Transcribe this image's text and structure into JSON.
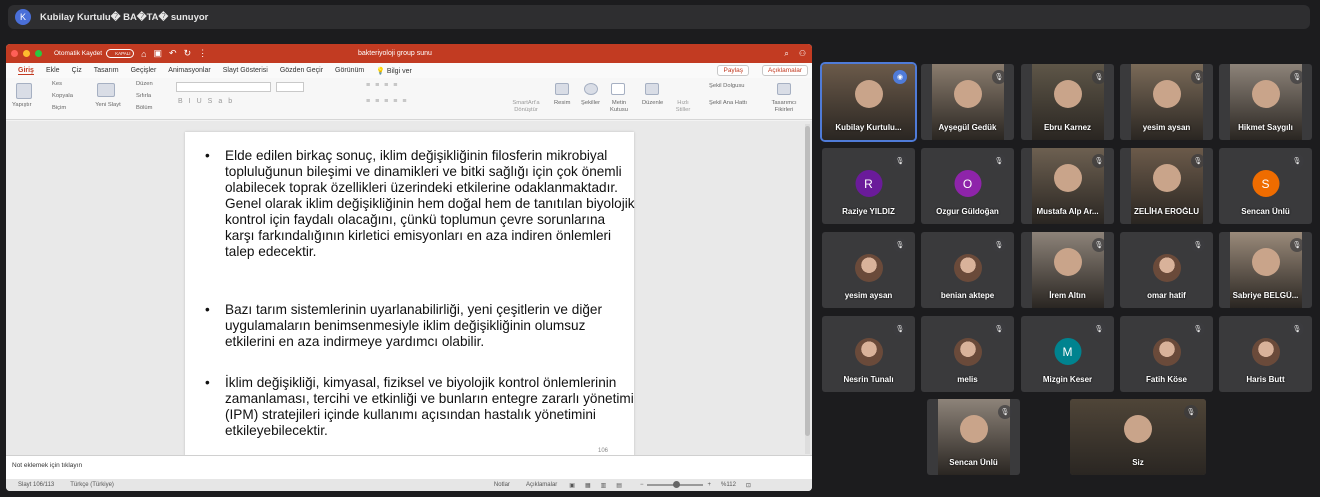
{
  "meeting": {
    "presenter_initial": "K",
    "presenter_banner": "Kubilay Kurtulu� BA�TA� sunuyor"
  },
  "ppt": {
    "autosave_label": "Otomatik Kaydet",
    "autosave_state": "KAPALI",
    "document_title": "bakteriyoloji group sunu",
    "tabs": [
      "Giriş",
      "Ekle",
      "Çiz",
      "Tasarım",
      "Geçişler",
      "Animasyonlar",
      "Slayt Gösterisi",
      "Gözden Geçir",
      "Görünüm",
      "Bilgi ver"
    ],
    "share_label": "Paylaş",
    "comments_label": "Açıklamalar",
    "ribbon": {
      "paste": "Yapıştır",
      "cut": "Kes",
      "copy": "Kopyala",
      "format": "Biçim",
      "new_slide": "Yeni Slayt",
      "layout": "Düzen",
      "reset": "Sıfırla",
      "section": "Bölüm",
      "smartart": "SmartArt'a Dönüştür",
      "picture": "Resim",
      "shapes": "Şekiller",
      "textbox": "Metin Kutusu",
      "arrange": "Düzenle",
      "quick_styles": "Hızlı Stiller",
      "shape_fill": "Şekil Dolgusu",
      "shape_outline": "Şekil Ana Hattı",
      "designer": "Tasarımcı Fikirleri"
    },
    "slide": {
      "bullet1": "Elde edilen birkaç sonuç, iklim değişikliğinin filosferin mikrobiyal topluluğunun bileşimi ve dinamikleri ve bitki sağlığı için çok önemli olabilecek toprak özellikleri üzerindeki etkilerine odaklanmaktadır. Genel olarak iklim değişikliğinin hem doğal hem de tanıtılan biyolojik kontrol için faydalı olacağını, çünkü toplumun çevre sorunlarına karşı farkındalığının kirletici emisyonları en aza indiren önlemleri talep edecektir.",
      "bullet2": "Bazı tarım sistemlerinin uyarlanabilirliği, yeni çeşitlerin ve diğer uygulamaların benimsenmesiyle iklim değişikliğinin olumsuz etkilerini en aza indirmeye yardımcı olabilir.",
      "bullet3": "İklim değişikliği, kimyasal, fiziksel ve biyolojik kontrol önlemlerinin zamanlaması, tercihi ve etkinliği ve bunların entegre zararlı yönetimi (IPM) stratejileri içinde kullanımı açısından hastalık yönetimini etkileyebilecektir.",
      "page_number": "106"
    },
    "notes_placeholder": "Not eklemek için tıklayın",
    "status": {
      "slide_info": "Slayt 106/113",
      "language": "Türkçe (Türkiye)",
      "notes": "Notlar",
      "comments": "Açıklamalar",
      "zoom": "%112"
    }
  },
  "participants": [
    {
      "name": "Kubilay Kurtulu...",
      "type": "photo",
      "active": true
    },
    {
      "name": "Ayşegül Gedük",
      "type": "photo"
    },
    {
      "name": "Ebru Karnez",
      "type": "photo"
    },
    {
      "name": "yesim aysan",
      "type": "photo"
    },
    {
      "name": "Hikmet Saygılı",
      "type": "photo"
    },
    {
      "name": "Raziye YILDIZ",
      "type": "initial",
      "initial": "R",
      "color": "#6a1b9a"
    },
    {
      "name": "Ozgur Güldoğan",
      "type": "initial",
      "initial": "O",
      "color": "#8e24aa"
    },
    {
      "name": "Mustafa Alp Ar...",
      "type": "photo"
    },
    {
      "name": "ZELİHA EROĞLU",
      "type": "photo"
    },
    {
      "name": "Sencan Ünlü",
      "type": "initial",
      "initial": "S",
      "color": "#ef6c00"
    },
    {
      "name": "yesim aysan",
      "type": "avatar"
    },
    {
      "name": "benian aktepe",
      "type": "avatar"
    },
    {
      "name": "İrem Altın",
      "type": "photo"
    },
    {
      "name": "omar hatif",
      "type": "avatar"
    },
    {
      "name": "Sabriye BELGÜ...",
      "type": "photo"
    },
    {
      "name": "Nesrin Tunalı",
      "type": "avatar"
    },
    {
      "name": "melis",
      "type": "avatar"
    },
    {
      "name": "Mizgin Keser",
      "type": "initial",
      "initial": "M",
      "color": "#00838f"
    },
    {
      "name": "Fatih Köse",
      "type": "avatar"
    },
    {
      "name": "Haris Butt",
      "type": "avatar"
    },
    {
      "name": "Sencan Ünlü",
      "type": "photo"
    },
    {
      "name": "Siz",
      "type": "photo"
    }
  ]
}
